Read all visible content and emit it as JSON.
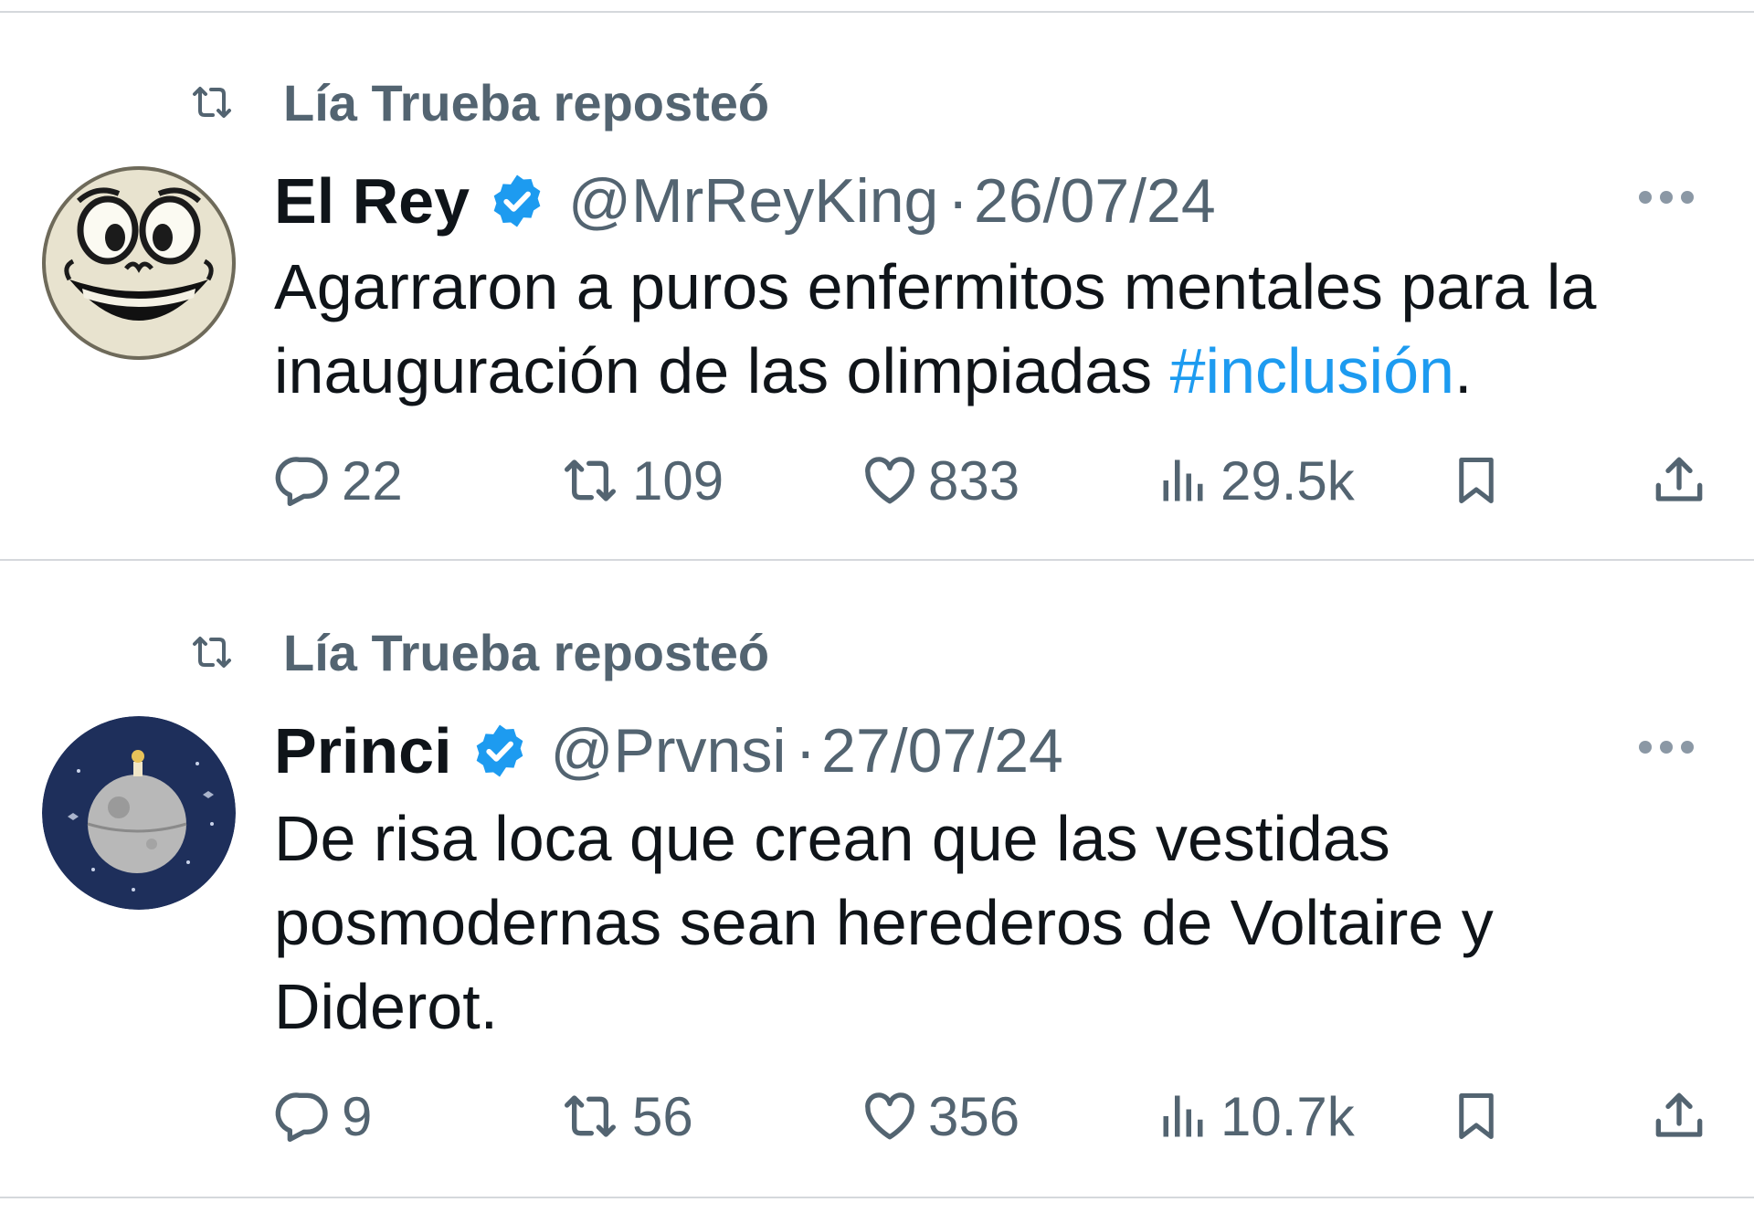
{
  "colors": {
    "text_primary": "#0f1419",
    "text_secondary": "#536471",
    "link": "#1d9bf0",
    "verified": "#1d9bf0",
    "divider": "#d5d8dc"
  },
  "tweets": [
    {
      "repost_label": "Lía Trueba reposteó",
      "author": {
        "name": "El Rey",
        "handle": "@MrReyKing",
        "verified": true,
        "avatar": "grinning-cartoon-face"
      },
      "separator": "·",
      "date": "26/07/24",
      "text": "Agarraron a puros enfermitos mentales para la inauguración de las olimpiadas ",
      "hashtag": "#inclusión",
      "text_end": ".",
      "stats": {
        "replies": "22",
        "reposts": "109",
        "likes": "833",
        "views": "29.5k"
      }
    },
    {
      "repost_label": "Lía Trueba reposteó",
      "author": {
        "name": "Princi",
        "handle": "@Prvnsi",
        "verified": true,
        "avatar": "death-star-little-prince"
      },
      "separator": "·",
      "date": "27/07/24",
      "text": "De risa loca que crean que las vestidas posmodernas sean herederos de Voltaire y Diderot.",
      "stats": {
        "replies": "9",
        "reposts": "56",
        "likes": "356",
        "views": "10.7k"
      }
    }
  ]
}
